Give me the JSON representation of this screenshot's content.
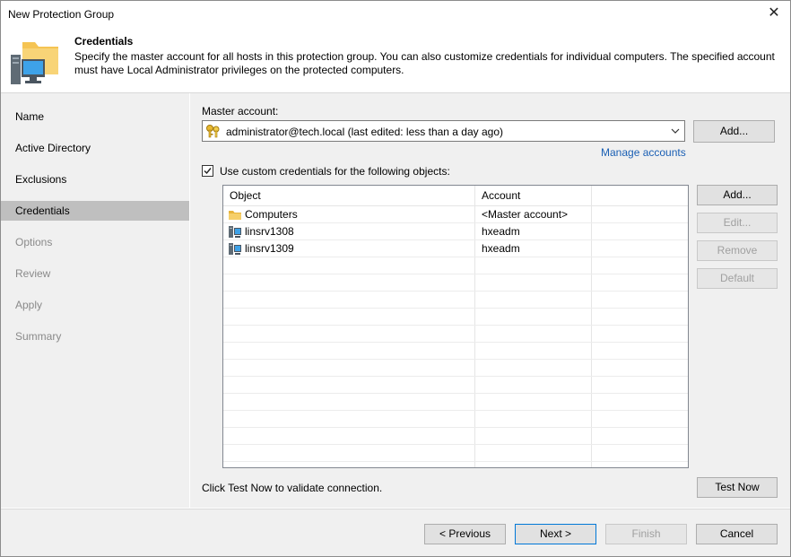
{
  "window": {
    "title": "New Protection Group",
    "close_glyph": "✕"
  },
  "header": {
    "title": "Credentials",
    "description": "Specify the master account for all hosts in this protection group. You can also customize credentials for individual computers. The specified account must have Local Administrator privileges on the protected computers.",
    "icon": "folder-computer-icon"
  },
  "sidebar": {
    "items": [
      {
        "label": "Name",
        "state": "normal"
      },
      {
        "label": "Active Directory",
        "state": "normal"
      },
      {
        "label": "Exclusions",
        "state": "normal"
      },
      {
        "label": "Credentials",
        "state": "active"
      },
      {
        "label": "Options",
        "state": "disabled"
      },
      {
        "label": "Review",
        "state": "disabled"
      },
      {
        "label": "Apply",
        "state": "disabled"
      },
      {
        "label": "Summary",
        "state": "disabled"
      }
    ]
  },
  "master_account": {
    "label": "Master account:",
    "value": "administrator@tech.local (last edited: less than a day ago)",
    "add_label": "Add...",
    "manage_link": "Manage accounts"
  },
  "custom_credentials": {
    "checkbox_label": "Use custom credentials for the following objects:",
    "checked": true,
    "columns": [
      "Object",
      "Account"
    ],
    "rows": [
      {
        "object": "Computers",
        "account": "<Master account>",
        "icon": "folder-icon"
      },
      {
        "object": "linsrv1308",
        "account": "hxeadm",
        "icon": "server-icon"
      },
      {
        "object": "linsrv1309",
        "account": "hxeadm",
        "icon": "server-icon"
      }
    ],
    "buttons": {
      "add": "Add...",
      "edit": "Edit...",
      "remove": "Remove",
      "default": "Default"
    }
  },
  "test": {
    "hint": "Click Test Now to validate connection.",
    "button": "Test Now"
  },
  "footer": {
    "previous": "< Previous",
    "next": "Next >",
    "finish": "Finish",
    "cancel": "Cancel"
  },
  "colors": {
    "accent": "#0078d7",
    "link": "#1a5fb4",
    "sidebar_bg": "#f0f0f0",
    "active_item": "#bfbfbf"
  }
}
